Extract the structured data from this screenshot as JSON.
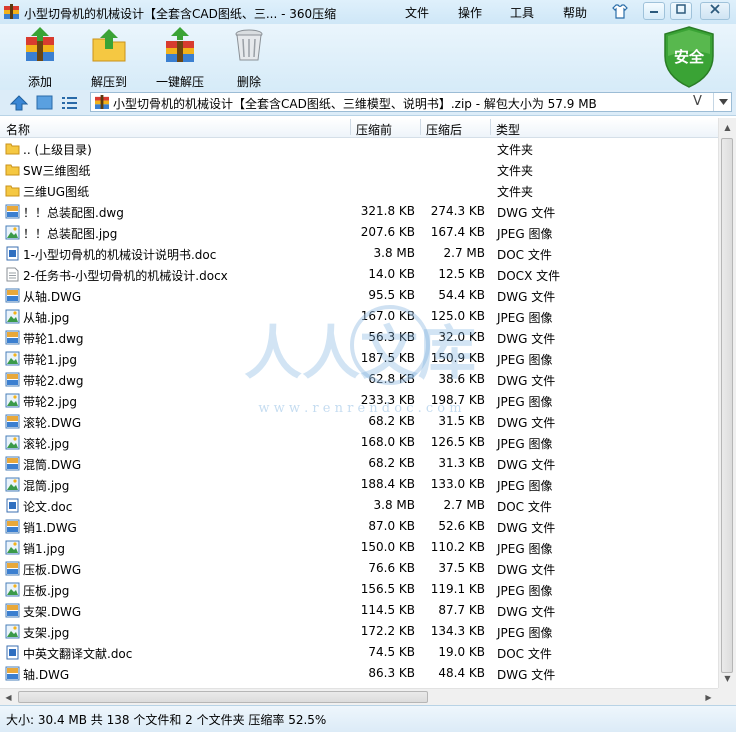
{
  "window": {
    "title": "小型切骨机的机械设计【全套含CAD图纸、三... - 360压缩",
    "menu": [
      "文件",
      "操作",
      "工具",
      "帮助"
    ]
  },
  "toolbar": {
    "add_label": "添加",
    "extract_to_label": "解压到",
    "one_click_extract_label": "一键解压",
    "delete_label": "删除",
    "security_label": "安全"
  },
  "address": {
    "path": "小型切骨机的机械设计【全套含CAD图纸、三维模型、说明书】.zip - 解包大小为 57.9 MB",
    "dropdown_glyph": "V"
  },
  "columns": {
    "name": "名称",
    "size": "压缩前",
    "packed": "压缩后",
    "type": "类型"
  },
  "files": [
    {
      "name": ".. (上级目录)",
      "size": "",
      "packed": "",
      "type": "文件夹",
      "icon": "folder"
    },
    {
      "name": "SW三维图纸",
      "size": "",
      "packed": "",
      "type": "文件夹",
      "icon": "folder"
    },
    {
      "name": "三维UG图纸",
      "size": "",
      "packed": "",
      "type": "文件夹",
      "icon": "folder"
    },
    {
      "name": "！！总装配图.dwg",
      "size": "321.8 KB",
      "packed": "274.3 KB",
      "type": "DWG 文件",
      "icon": "dwg"
    },
    {
      "name": "！！总装配图.jpg",
      "size": "207.6 KB",
      "packed": "167.4 KB",
      "type": "JPEG 图像",
      "icon": "jpg"
    },
    {
      "name": "1-小型切骨机的机械设计说明书.doc",
      "size": "3.8 MB",
      "packed": "2.7 MB",
      "type": "DOC 文件",
      "icon": "doc"
    },
    {
      "name": "2-任务书-小型切骨机的机械设计.docx",
      "size": "14.0 KB",
      "packed": "12.5 KB",
      "type": "DOCX 文件",
      "icon": "docx"
    },
    {
      "name": "从轴.DWG",
      "size": "95.5 KB",
      "packed": "54.4 KB",
      "type": "DWG 文件",
      "icon": "dwg"
    },
    {
      "name": "从轴.jpg",
      "size": "167.0 KB",
      "packed": "125.0 KB",
      "type": "JPEG 图像",
      "icon": "jpg"
    },
    {
      "name": "带轮1.dwg",
      "size": "56.3 KB",
      "packed": "32.0 KB",
      "type": "DWG 文件",
      "icon": "dwg"
    },
    {
      "name": "带轮1.jpg",
      "size": "187.5 KB",
      "packed": "150.9 KB",
      "type": "JPEG 图像",
      "icon": "jpg"
    },
    {
      "name": "带轮2.dwg",
      "size": "62.8 KB",
      "packed": "38.6 KB",
      "type": "DWG 文件",
      "icon": "dwg"
    },
    {
      "name": "带轮2.jpg",
      "size": "233.3 KB",
      "packed": "198.7 KB",
      "type": "JPEG 图像",
      "icon": "jpg"
    },
    {
      "name": "滚轮.DWG",
      "size": "68.2 KB",
      "packed": "31.5 KB",
      "type": "DWG 文件",
      "icon": "dwg"
    },
    {
      "name": "滚轮.jpg",
      "size": "168.0 KB",
      "packed": "126.5 KB",
      "type": "JPEG 图像",
      "icon": "jpg"
    },
    {
      "name": "混筒.DWG",
      "size": "68.2 KB",
      "packed": "31.3 KB",
      "type": "DWG 文件",
      "icon": "dwg"
    },
    {
      "name": "混筒.jpg",
      "size": "188.4 KB",
      "packed": "133.0 KB",
      "type": "JPEG 图像",
      "icon": "jpg"
    },
    {
      "name": "论文.doc",
      "size": "3.8 MB",
      "packed": "2.7 MB",
      "type": "DOC 文件",
      "icon": "doc"
    },
    {
      "name": "销1.DWG",
      "size": "87.0 KB",
      "packed": "52.6 KB",
      "type": "DWG 文件",
      "icon": "dwg"
    },
    {
      "name": "销1.jpg",
      "size": "150.0 KB",
      "packed": "110.2 KB",
      "type": "JPEG 图像",
      "icon": "jpg"
    },
    {
      "name": "压板.DWG",
      "size": "76.6 KB",
      "packed": "37.5 KB",
      "type": "DWG 文件",
      "icon": "dwg"
    },
    {
      "name": "压板.jpg",
      "size": "156.5 KB",
      "packed": "119.1 KB",
      "type": "JPEG 图像",
      "icon": "jpg"
    },
    {
      "name": "支架.DWG",
      "size": "114.5 KB",
      "packed": "87.7 KB",
      "type": "DWG 文件",
      "icon": "dwg"
    },
    {
      "name": "支架.jpg",
      "size": "172.2 KB",
      "packed": "134.3 KB",
      "type": "JPEG 图像",
      "icon": "jpg"
    },
    {
      "name": "中英文翻译文献.doc",
      "size": "74.5 KB",
      "packed": "19.0 KB",
      "type": "DOC 文件",
      "icon": "doc"
    },
    {
      "name": "轴.DWG",
      "size": "86.3 KB",
      "packed": "48.4 KB",
      "type": "DWG 文件",
      "icon": "dwg"
    }
  ],
  "status": {
    "text": "大小: 30.4 MB 共 138 个文件和 2 个文件夹 压缩率 52.5%"
  },
  "watermark": {
    "text": "人人文库",
    "url": "w w w . r e n r e n d o c . c o m"
  },
  "colors": {
    "accent": "#3a7bbf",
    "titlebar": "#cfe7f7",
    "shield": "#3aa335"
  }
}
